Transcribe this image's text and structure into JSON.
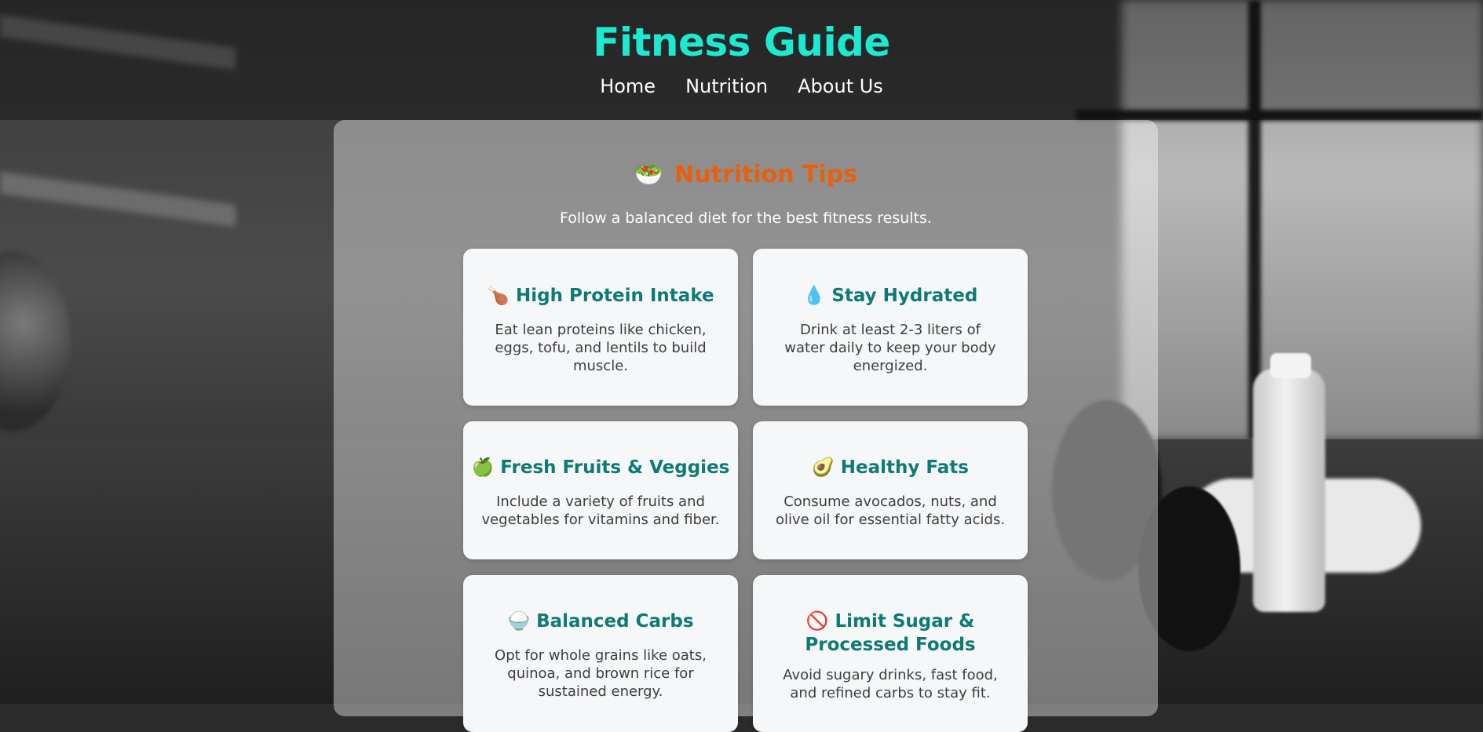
{
  "site": {
    "title": "Fitness Guide"
  },
  "nav": {
    "items": [
      "Home",
      "Nutrition",
      "About Us"
    ]
  },
  "section": {
    "icon": "🥗",
    "title": "Nutrition Tips",
    "subtitle": "Follow a balanced diet for the best fitness results."
  },
  "cards": [
    {
      "icon": "🍗",
      "title": "High Protein Intake",
      "text": "Eat lean proteins like chicken, eggs, tofu, and lentils to build muscle."
    },
    {
      "icon": "💧",
      "title": "Stay Hydrated",
      "text": "Drink at least 2-3 liters of water daily to keep your body energized."
    },
    {
      "icon": "🍏",
      "title": "Fresh Fruits & Veggies",
      "text": "Include a variety of fruits and vegetables for vitamins and fiber."
    },
    {
      "icon": "🥑",
      "title": "Healthy Fats",
      "text": "Consume avocados, nuts, and olive oil for essential fatty acids."
    },
    {
      "icon": "🍚",
      "title": "Balanced Carbs",
      "text": "Opt for whole grains like oats, quinoa, and brown rice for sustained energy."
    },
    {
      "icon": "🚫",
      "title": "Limit Sugar & Processed Foods",
      "text": "Avoid sugary drinks, fast food, and refined carbs to stay fit."
    }
  ],
  "colors": {
    "title": "#1de9d0",
    "section_title": "#e8600c",
    "card_title": "#0f7a73"
  }
}
